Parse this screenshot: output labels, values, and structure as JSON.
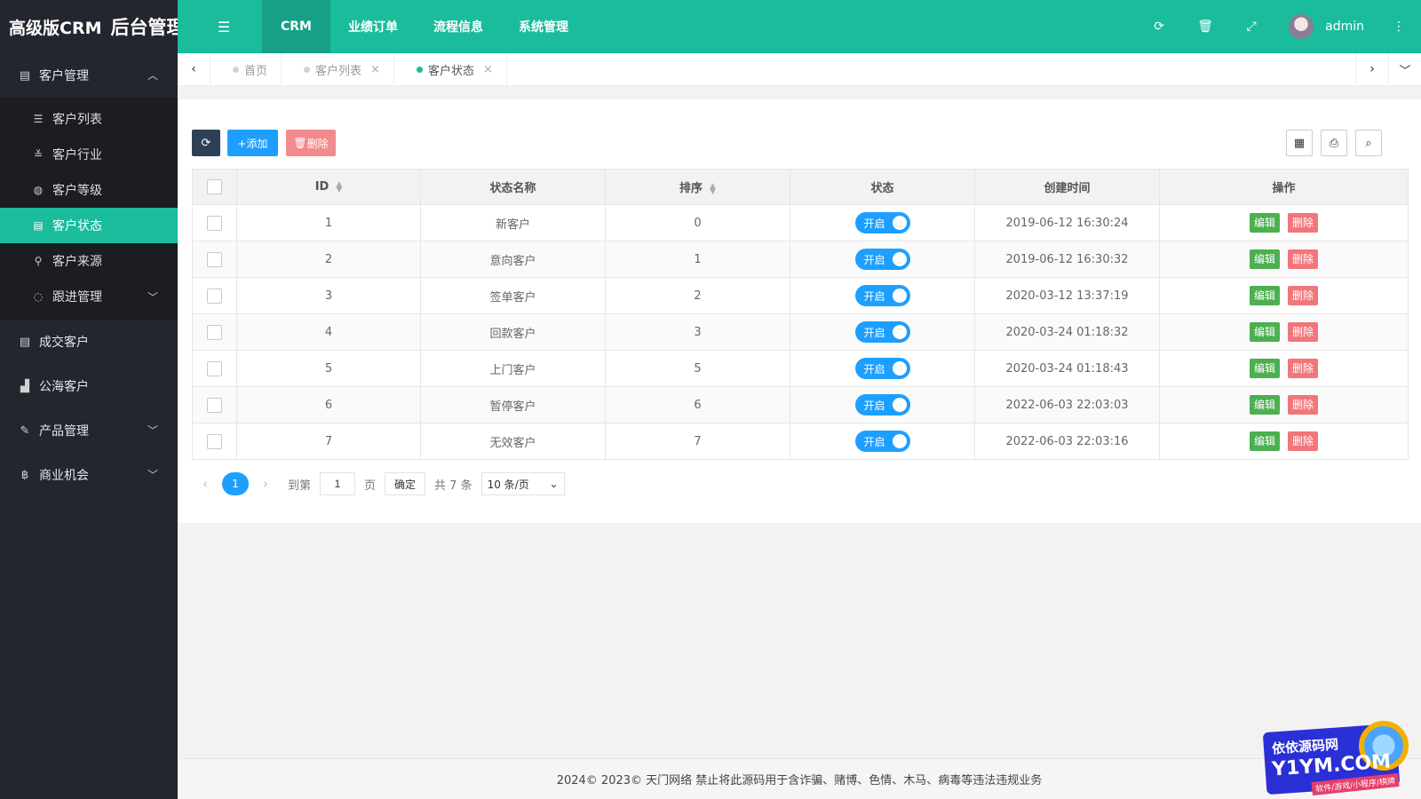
{
  "app": {
    "logo_main": "高级版CRM",
    "logo_sub": "后台管理"
  },
  "header": {
    "nav": [
      "CRM",
      "业绩订单",
      "流程信息",
      "系统管理"
    ],
    "user": "admin"
  },
  "sidebar": {
    "groups": [
      {
        "label": "客户管理",
        "icon": "id-card-icon",
        "expanded": true,
        "items": [
          {
            "label": "客户列表",
            "icon": "list-icon"
          },
          {
            "label": "客户行业",
            "icon": "industry-icon"
          },
          {
            "label": "客户等级",
            "icon": "level-icon"
          },
          {
            "label": "客户状态",
            "icon": "status-icon",
            "active": true
          },
          {
            "label": "客户来源",
            "icon": "walker-icon"
          },
          {
            "label": "跟进管理",
            "icon": "chat-icon",
            "has_children": true
          }
        ]
      },
      {
        "label": "成交客户",
        "icon": "id-card-icon"
      },
      {
        "label": "公海客户",
        "icon": "chart-icon"
      },
      {
        "label": "产品管理",
        "icon": "brush-icon",
        "has_children": true
      },
      {
        "label": "商业机会",
        "icon": "bitcoin-icon",
        "has_children": true
      }
    ]
  },
  "tabs": [
    {
      "label": "首页",
      "closable": false
    },
    {
      "label": "客户列表",
      "closable": true
    },
    {
      "label": "客户状态",
      "closable": true,
      "active": true
    }
  ],
  "toolbar": {
    "add_label": "+添加",
    "delete_label": "删除"
  },
  "table": {
    "headers": [
      "ID",
      "状态名称",
      "排序",
      "状态",
      "创建时间",
      "操作"
    ],
    "rows": [
      {
        "id": "1",
        "name": "新客户",
        "sort": "0",
        "status": "开启",
        "created": "2019-06-12 16:30:24"
      },
      {
        "id": "2",
        "name": "意向客户",
        "sort": "1",
        "status": "开启",
        "created": "2019-06-12 16:30:32"
      },
      {
        "id": "3",
        "name": "签单客户",
        "sort": "2",
        "status": "开启",
        "created": "2020-03-12 13:37:19"
      },
      {
        "id": "4",
        "name": "回款客户",
        "sort": "3",
        "status": "开启",
        "created": "2020-03-24 01:18:32"
      },
      {
        "id": "5",
        "name": "上门客户",
        "sort": "5",
        "status": "开启",
        "created": "2020-03-24 01:18:43"
      },
      {
        "id": "6",
        "name": "暂停客户",
        "sort": "6",
        "status": "开启",
        "created": "2022-06-03 22:03:03"
      },
      {
        "id": "7",
        "name": "无效客户",
        "sort": "7",
        "status": "开启",
        "created": "2022-06-03 22:03:16"
      }
    ],
    "edit_label": "编辑",
    "delete_label": "删除"
  },
  "pager": {
    "current": "1",
    "goto_label": "到第",
    "goto_value": "1",
    "page_label": "页",
    "confirm_label": "确定",
    "total_label": "共 7 条",
    "page_size": "10 条/页"
  },
  "footer": "2024© 2023© 天门网络 禁止将此源码用于含诈骗、赌博、色情、木马、病毒等违法违规业务",
  "watermark": {
    "line1": "依依源码网",
    "line2": "Y1YM.COM",
    "line3": "软件/游戏/小程序/棋牌"
  },
  "colors": {
    "primary": "#1abc9c",
    "sidebar": "#23262e",
    "blue": "#1e9fff",
    "danger": "#f1767a",
    "edit": "#4caf50"
  }
}
